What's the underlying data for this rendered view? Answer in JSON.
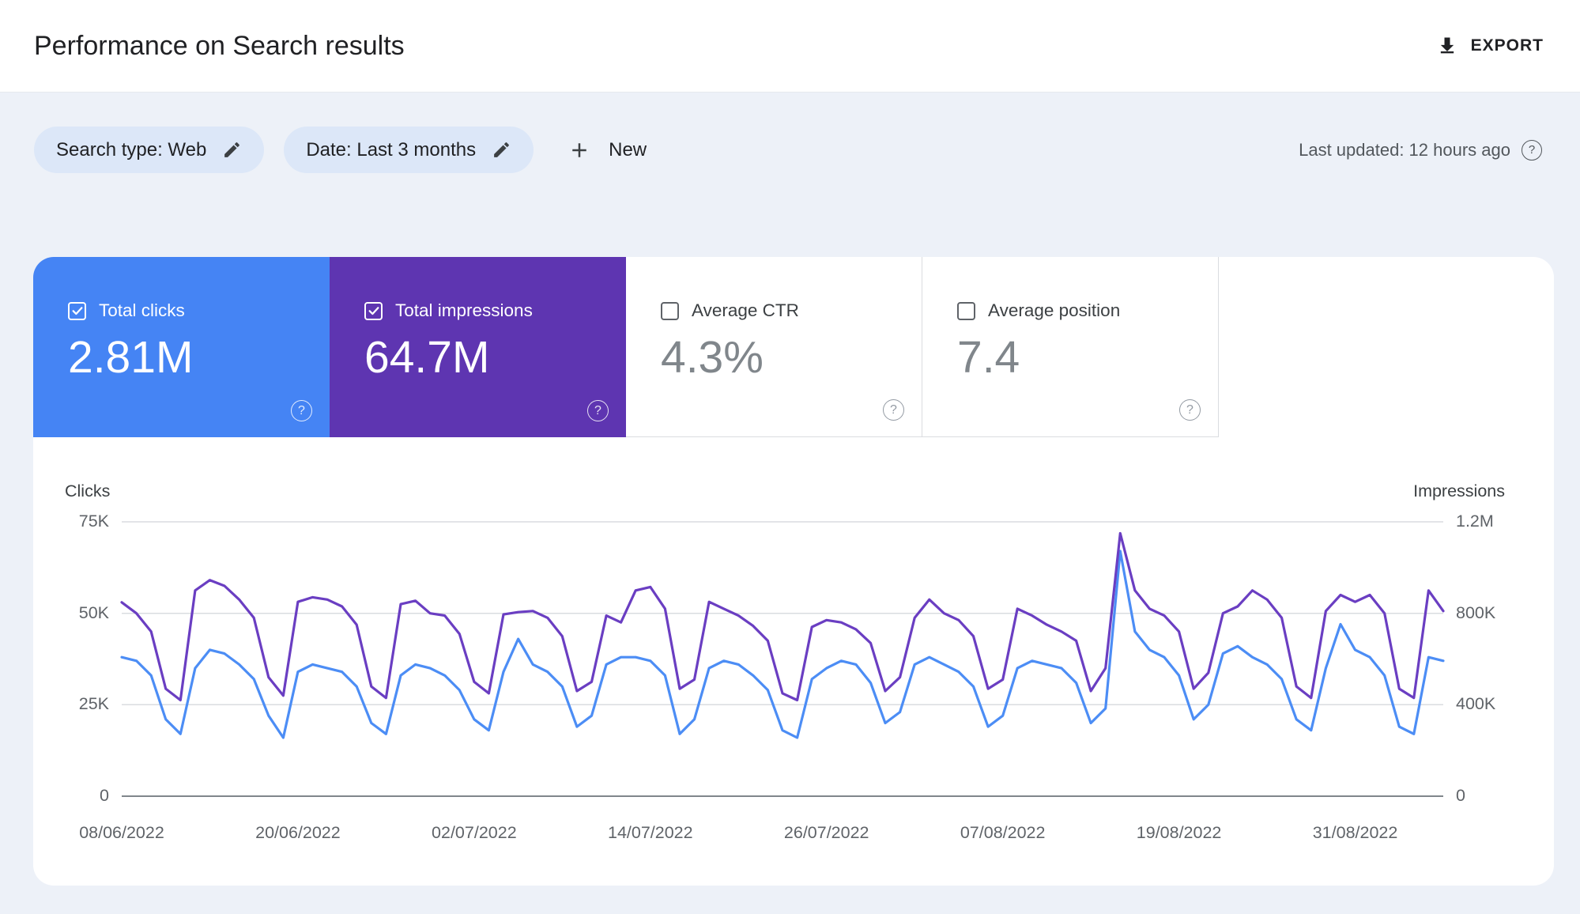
{
  "header": {
    "title": "Performance on Search results",
    "export_label": "EXPORT"
  },
  "filters": {
    "search_type_chip": "Search type: Web",
    "date_chip": "Date: Last 3 months",
    "new_label": "New",
    "last_updated": "Last updated: 12 hours ago"
  },
  "metrics": [
    {
      "id": "total-clicks",
      "label": "Total clicks",
      "value": "2.81M",
      "checked": true,
      "color": "#4584f4"
    },
    {
      "id": "total-impressions",
      "label": "Total impressions",
      "value": "64.7M",
      "checked": true,
      "color": "#5e35b1"
    },
    {
      "id": "average-ctr",
      "label": "Average CTR",
      "value": "4.3%",
      "checked": false,
      "color": ""
    },
    {
      "id": "average-position",
      "label": "Average position",
      "value": "7.4",
      "checked": false,
      "color": ""
    }
  ],
  "chart_data": {
    "type": "line",
    "granularity": "daily",
    "grid": true,
    "left_axis": {
      "label": "Clicks",
      "ticks": [
        "75K",
        "50K",
        "25K",
        "0"
      ],
      "min": 0,
      "max": 75000
    },
    "right_axis": {
      "label": "Impressions",
      "ticks": [
        "1.2M",
        "800K",
        "400K",
        "0"
      ],
      "min": 0,
      "max": 1200000
    },
    "x_tick_labels": [
      "08/06/2022",
      "20/06/2022",
      "02/07/2022",
      "14/07/2022",
      "26/07/2022",
      "07/08/2022",
      "19/08/2022",
      "31/08/2022"
    ],
    "x_tick_indices": [
      0,
      12,
      24,
      36,
      48,
      60,
      72,
      84
    ],
    "series": [
      {
        "name": "Clicks",
        "axis": "left",
        "color": "#4c8df5",
        "values": [
          38000,
          37000,
          33000,
          21000,
          17000,
          35000,
          40000,
          39000,
          36000,
          32000,
          22000,
          16000,
          34000,
          36000,
          35000,
          34000,
          30000,
          20000,
          17000,
          33000,
          36000,
          35000,
          33000,
          29000,
          21000,
          18000,
          34000,
          43000,
          36000,
          34000,
          30000,
          19000,
          22000,
          36000,
          38000,
          38000,
          37000,
          33000,
          17000,
          21000,
          35000,
          37000,
          36000,
          33000,
          29000,
          18000,
          16000,
          32000,
          35000,
          37000,
          36000,
          31000,
          20000,
          23000,
          36000,
          38000,
          36000,
          34000,
          30000,
          19000,
          22000,
          35000,
          37000,
          36000,
          35000,
          31000,
          20000,
          24000,
          67000,
          45000,
          40000,
          38000,
          33000,
          21000,
          25000,
          39000,
          41000,
          38000,
          36000,
          32000,
          21000,
          18000,
          35000,
          47000,
          40000,
          38000,
          33000,
          19000,
          17000,
          38000,
          37000
        ]
      },
      {
        "name": "Impressions",
        "axis": "right",
        "color": "#6a3ec2",
        "values": [
          848000,
          800000,
          720000,
          470000,
          420000,
          900000,
          945000,
          920000,
          860000,
          780000,
          520000,
          440000,
          850000,
          870000,
          860000,
          830000,
          750000,
          480000,
          430000,
          840000,
          855000,
          800000,
          790000,
          710000,
          500000,
          450000,
          795000,
          805000,
          810000,
          780000,
          700000,
          460000,
          500000,
          790000,
          760000,
          900000,
          915000,
          820000,
          470000,
          510000,
          850000,
          820000,
          790000,
          745000,
          680000,
          450000,
          420000,
          740000,
          770000,
          760000,
          730000,
          670000,
          460000,
          520000,
          780000,
          860000,
          800000,
          770000,
          700000,
          470000,
          510000,
          820000,
          790000,
          750000,
          720000,
          680000,
          460000,
          560000,
          1150000,
          900000,
          820000,
          790000,
          720000,
          470000,
          540000,
          800000,
          830000,
          900000,
          860000,
          780000,
          480000,
          430000,
          810000,
          880000,
          850000,
          880000,
          800000,
          470000,
          430000,
          900000,
          810000
        ]
      }
    ]
  }
}
